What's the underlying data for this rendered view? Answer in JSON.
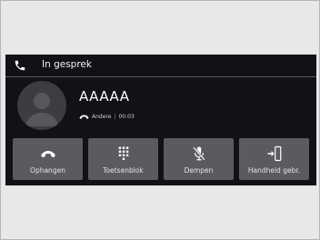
{
  "header": {
    "title": "In gesprek",
    "icon": "phone-icon"
  },
  "caller": {
    "name": "AAAAA",
    "status_icon": "handset-icon",
    "status": "Andere",
    "separator": "|",
    "duration": "00:03"
  },
  "actions": [
    {
      "label": "Ophangen",
      "icon": "hang-up-icon"
    },
    {
      "label": "Toetsenblok",
      "icon": "keypad-icon"
    },
    {
      "label": "Dempen",
      "icon": "mute-microphone-icon"
    },
    {
      "label": "Handheld gebr.",
      "icon": "handheld-transfer-icon"
    }
  ],
  "colors": {
    "background": "#e8e8e8",
    "screen": "#111215",
    "button": "#5a5b5f",
    "text": "#ffffff"
  }
}
